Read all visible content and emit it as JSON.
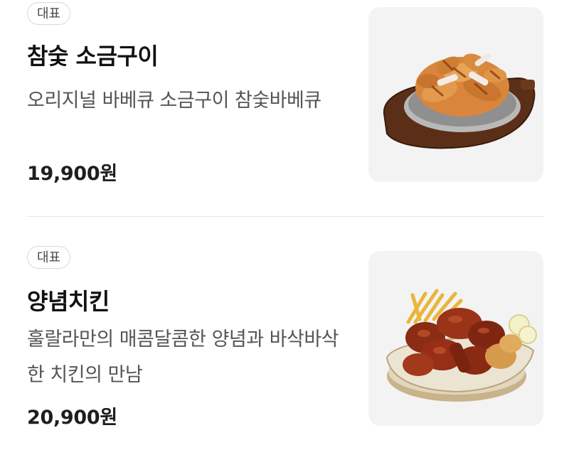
{
  "menu": [
    {
      "badge": "대표",
      "name": "참숯 소금구이",
      "description": "오리지널 바베큐 소금구이 참숯바베큐",
      "price": "19,900원",
      "image_icon": "grilled-chicken-platter-photo"
    },
    {
      "badge": "대표",
      "name": "양념치킨",
      "description": "훌랄라만의 매콤달콤한 양념과 바삭바삭한 치킨의 만남",
      "price": "20,900원",
      "image_icon": "seasoned-chicken-basket-photo"
    }
  ]
}
